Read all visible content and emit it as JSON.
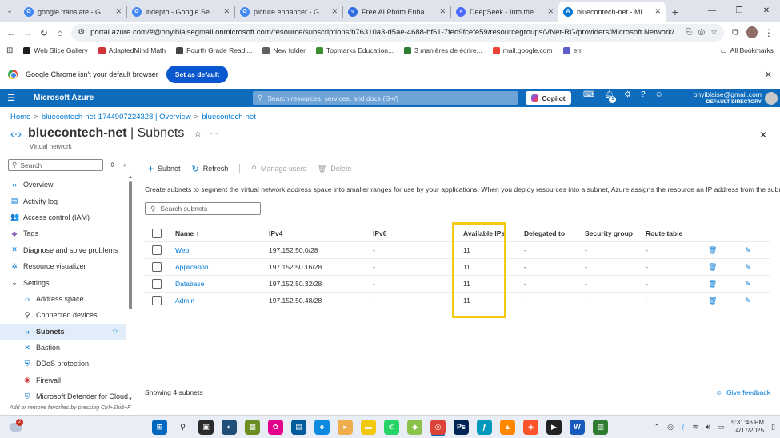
{
  "browser": {
    "tabs": [
      {
        "title": "google translate - Google",
        "color": "#4285f4",
        "glyph": "G"
      },
      {
        "title": "indepth - Google Search",
        "color": "#4285f4",
        "glyph": "G"
      },
      {
        "title": "picture enhancer - Google",
        "color": "#4285f4",
        "glyph": "G"
      },
      {
        "title": "Free AI Photo Enhancer: En",
        "color": "#2f6de1",
        "glyph": "✎"
      },
      {
        "title": "DeepSeek - Into the Unkno",
        "color": "#4d6bfe",
        "glyph": "◗"
      },
      {
        "title": "bluecontech-net - Microsof",
        "color": "#0078d4",
        "glyph": "A",
        "active": true
      }
    ],
    "url": "portal.azure.com/#@onyiblaisegmail.onmicrosoft.com/resource/subscriptions/b76310a3-d5ae-4688-bf61-7fed9fcefe59/resourcegroups/VNet-RG/providers/Microsoft.Network/...",
    "bookmarks": [
      {
        "label": "Web Slice Gallery",
        "color": "#1e1e1e"
      },
      {
        "label": "AdaptedMind Math",
        "color": "#d13438"
      },
      {
        "label": "Fourth Grade Readi...",
        "color": "#444444"
      },
      {
        "label": "New folder",
        "color": "#606060"
      },
      {
        "label": "Topmarks Education...",
        "color": "#3c8d2f"
      },
      {
        "label": "3 manières de écrire...",
        "color": "#2e7d32"
      },
      {
        "label": "mail.google.com",
        "color": "#ea4335"
      },
      {
        "label": "err",
        "color": "#5b5fc7"
      }
    ],
    "all_bookmarks": "All Bookmarks",
    "banner_text": "Google Chrome isn't your default browser",
    "banner_button": "Set as default"
  },
  "azure": {
    "brand": "Microsoft Azure",
    "search_placeholder": "Search resources, services, and docs (G+/)",
    "copilot": "Copilot",
    "notification_count": "1",
    "account_email": "onyiblaise@gmail.com",
    "account_dir": "DEFAULT DIRECTORY"
  },
  "breadcrumb": {
    "home": "Home",
    "sep": ">",
    "overview": "bluecontech-net-1744907224328 | Overview",
    "current": "bluecontech-net"
  },
  "page": {
    "resource_name": "bluecontech-net",
    "blade_name": " | Subnets",
    "subtitle": "Virtual network"
  },
  "leftnav": {
    "search_placeholder": "Search",
    "items": [
      {
        "label": "Overview",
        "icon": "‹›",
        "color": "#0078d4",
        "sub": false
      },
      {
        "label": "Activity log",
        "icon": "▤",
        "color": "#0078d4",
        "sub": false
      },
      {
        "label": "Access control (IAM)",
        "icon": "👥",
        "color": "#0078d4",
        "sub": false
      },
      {
        "label": "Tags",
        "icon": "◆",
        "color": "#8764b8",
        "sub": false
      },
      {
        "label": "Diagnose and solve problems",
        "icon": "✕",
        "color": "#0078d4",
        "sub": false
      },
      {
        "label": "Resource visualizer",
        "icon": "✲",
        "color": "#0078d4",
        "sub": false
      },
      {
        "label": "Settings",
        "icon": "⌄",
        "color": "#323130",
        "sub": false
      },
      {
        "label": "Address space",
        "icon": "‹›",
        "color": "#0078d4",
        "sub": true
      },
      {
        "label": "Connected devices",
        "icon": "⚲",
        "color": "#323130",
        "sub": true
      },
      {
        "label": "Subnets",
        "icon": "‹›",
        "color": "#0078d4",
        "sub": true,
        "active": true
      },
      {
        "label": "Bastion",
        "icon": "✕",
        "color": "#0078d4",
        "sub": true
      },
      {
        "label": "DDoS protection",
        "icon": "⛨",
        "color": "#0078d4",
        "sub": true
      },
      {
        "label": "Firewall",
        "icon": "◉",
        "color": "#d13438",
        "sub": true
      },
      {
        "label": "Microsoft Defender for Cloud",
        "icon": "⛨",
        "color": "#0078d4",
        "sub": true
      }
    ],
    "fav_hint": "Add or remove favorites by pressing Ctrl+Shift+F"
  },
  "commands": {
    "add_subnet": "Subnet",
    "refresh": "Refresh",
    "manage_users": "Manage users",
    "delete": "Delete"
  },
  "description": "Create subnets to segment the virtual network address space into smaller ranges for use by your applications. When you deploy resources into a subnet, Azure assigns the resource an IP address from the subnet.",
  "subnet_search_placeholder": "Search subnets",
  "table": {
    "columns": {
      "name": "Name ↑",
      "ipv4": "IPv4",
      "ipv6": "IPv6",
      "available": "Available IPs",
      "delegated": "Delegated to",
      "security": "Security group",
      "route": "Route table"
    },
    "rows": [
      {
        "name": "Web",
        "ipv4": "197.152.50.0/28",
        "ipv6": "-",
        "available": "11",
        "delegated": "-",
        "security": "-",
        "route": "-"
      },
      {
        "name": "Application",
        "ipv4": "197.152.50.16/28",
        "ipv6": "-",
        "available": "11",
        "delegated": "-",
        "security": "-",
        "route": "-"
      },
      {
        "name": "Database",
        "ipv4": "197.152.50.32/28",
        "ipv6": "-",
        "available": "11",
        "delegated": "-",
        "security": "-",
        "route": "-"
      },
      {
        "name": "Admin",
        "ipv4": "197.152.50.48/28",
        "ipv6": "-",
        "available": "11",
        "delegated": "-",
        "security": "-",
        "route": "-"
      }
    ]
  },
  "footer": {
    "showing": "Showing 4 subnets",
    "feedback": "Give feedback"
  },
  "taskbar": {
    "weather_badge": "2",
    "time": "5:31:46 PM",
    "date": "4/17/2025",
    "apps": [
      {
        "name": "start",
        "color": "#0067c0",
        "glyph": "⊞"
      },
      {
        "name": "search",
        "color": "#e9eef6",
        "glyph": "⚲"
      },
      {
        "name": "task-view",
        "color": "#2b2b2b",
        "glyph": "▣"
      },
      {
        "name": "app-a",
        "color": "#1f4e79",
        "glyph": "◐"
      },
      {
        "name": "app-b",
        "color": "#6b8e23",
        "glyph": "▦"
      },
      {
        "name": "app-c",
        "color": "#e3008c",
        "glyph": "✿"
      },
      {
        "name": "app-d",
        "color": "#005a9e",
        "glyph": "▤"
      },
      {
        "name": "edge",
        "color": "#0c8ae0",
        "glyph": "e"
      },
      {
        "name": "app-e",
        "color": "#f0ad4e",
        "glyph": "▸"
      },
      {
        "name": "explorer",
        "color": "#f2c811",
        "glyph": "▬"
      },
      {
        "name": "whatsapp",
        "color": "#25d366",
        "glyph": "✆"
      },
      {
        "name": "app-f",
        "color": "#8bc34a",
        "glyph": "◆"
      },
      {
        "name": "chrome",
        "color": "#db4437",
        "glyph": "◎",
        "active": true
      },
      {
        "name": "powershell",
        "color": "#012456",
        "glyph": "Ps"
      },
      {
        "name": "app-g",
        "color": "#0099bc",
        "glyph": "ƒ"
      },
      {
        "name": "vlc",
        "color": "#ff8800",
        "glyph": "▲"
      },
      {
        "name": "brave",
        "color": "#fb542b",
        "glyph": "◈"
      },
      {
        "name": "media",
        "color": "#222222",
        "glyph": "▶"
      },
      {
        "name": "word",
        "color": "#185abd",
        "glyph": "W"
      },
      {
        "name": "app-h",
        "color": "#2e7d32",
        "glyph": "▥"
      }
    ]
  }
}
